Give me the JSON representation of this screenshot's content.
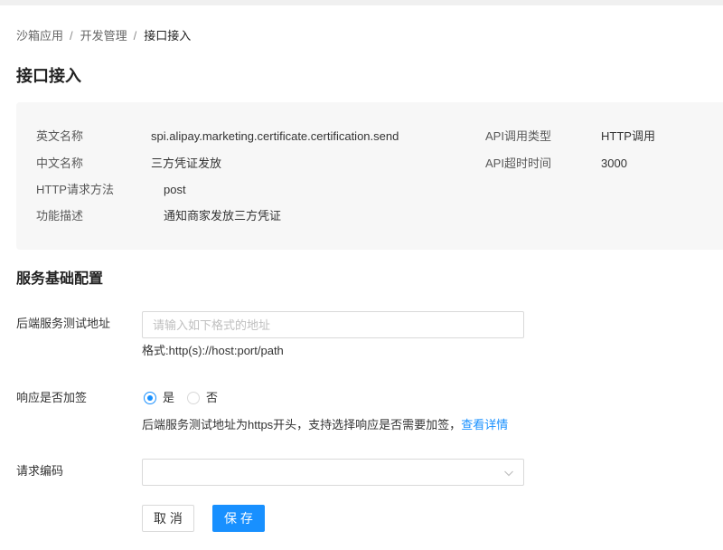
{
  "breadcrumb": {
    "separator": "/",
    "items": [
      {
        "label": "沙箱应用"
      },
      {
        "label": "开发管理"
      },
      {
        "label": "接口接入"
      }
    ]
  },
  "page_title": "接口接入",
  "api_info": {
    "english_name": {
      "label": "英文名称",
      "value": "spi.alipay.marketing.certificate.certification.send"
    },
    "chinese_name": {
      "label": "中文名称",
      "value": "三方凭证发放"
    },
    "http_method": {
      "label": "HTTP请求方法",
      "value": "post"
    },
    "description": {
      "label": "功能描述",
      "value": "通知商家发放三方凭证"
    },
    "call_type": {
      "label": "API调用类型",
      "value": "HTTP调用"
    },
    "timeout": {
      "label": "API超时时间",
      "value": "3000"
    }
  },
  "service_config": {
    "title": "服务基础配置",
    "backend_url": {
      "label": "后端服务测试地址",
      "placeholder": "请输入如下格式的地址",
      "hint": "格式:http(s)://host:port/path"
    },
    "response_sign": {
      "label": "响应是否加签",
      "options": [
        {
          "label": "是",
          "checked": true
        },
        {
          "label": "否",
          "checked": false
        }
      ],
      "hint": "后端服务测试地址为https开头，支持选择响应是否需要加签，",
      "link": "查看详情"
    },
    "request_encoding": {
      "label": "请求编码",
      "icon": "chevron-down-icon"
    }
  },
  "actions": {
    "cancel_label": "取 消",
    "save_label": "保 存"
  },
  "theme": {
    "primary": "#1890ff",
    "border": "#d9d9d9",
    "panel_bg": "#f7f7f7"
  }
}
